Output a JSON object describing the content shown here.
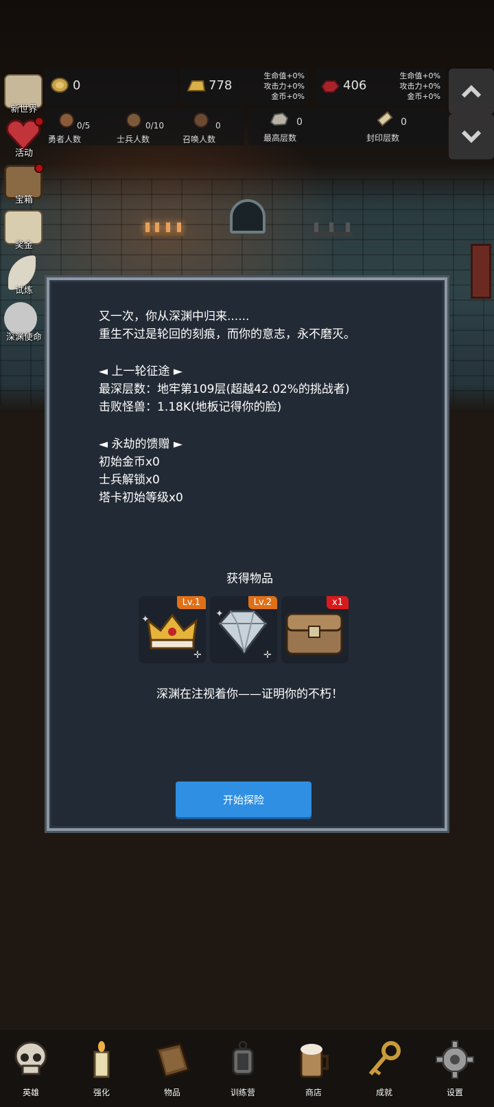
{
  "resources": {
    "gold": {
      "icon": "gold-coin-icon",
      "value": "0"
    },
    "gold_bar": {
      "icon": "gold-bar-icon",
      "value": "778",
      "bonus": [
        "生命值+0%",
        "攻击力+0%",
        "金币+0%"
      ]
    },
    "ruby": {
      "icon": "ruby-icon",
      "value": "406",
      "bonus": [
        "生命值+0%",
        "攻击力+0%",
        "金币+0%"
      ]
    }
  },
  "stats": [
    {
      "icon": "hero-head-icon",
      "value": "0/5",
      "label": "勇者人数"
    },
    {
      "icon": "soldier-head-icon",
      "value": "0/10",
      "label": "士兵人数"
    },
    {
      "icon": "summon-head-icon",
      "value": "0",
      "label": "召唤人数"
    },
    {
      "icon": "rock-icon",
      "value": "0",
      "label": "最高层数"
    },
    {
      "icon": "scroll-icon",
      "value": "0",
      "label": "封印层数"
    }
  ],
  "side_menu": [
    {
      "icon": "map-icon",
      "label": "新世界"
    },
    {
      "icon": "heart-icon",
      "label": "活动"
    },
    {
      "icon": "treasure-chest-icon",
      "label": "宝箱"
    },
    {
      "icon": "envelope-icon",
      "label": "奖金"
    },
    {
      "icon": "feather-icon",
      "label": "试炼"
    },
    {
      "icon": "orb-icon",
      "label": "深渊使命"
    }
  ],
  "modal": {
    "lines": [
      "又一次，你从深渊中归来......",
      "重生不过是轮回的刻痕，而你的意志，永不磨灭。",
      "◄ 上一轮征途 ►",
      "最深层数：地牢第109层(超越42.02%的挑战者)",
      "击败怪兽：1.18K(地板记得你的脸)",
      "◄ 永劫的馈赠 ►",
      "初始金币x0",
      "士兵解锁x0",
      "塔卡初始等级x0"
    ],
    "items_title": "获得物品",
    "items": [
      {
        "icon": "crown-icon",
        "badge": "Lv.1",
        "badge_color": "#e07018"
      },
      {
        "icon": "diamond-icon",
        "badge": "Lv.2",
        "badge_color": "#e07018"
      },
      {
        "icon": "treasure-chest-icon",
        "badge": "x1",
        "badge_color": "#d81a1a"
      }
    ],
    "footer": "深渊在注视着你——证明你的不朽！",
    "start_button": "开始探险"
  },
  "bottom_nav": [
    {
      "icon": "skull-icon",
      "label": "英雄"
    },
    {
      "icon": "candle-icon",
      "label": "强化"
    },
    {
      "icon": "book-icon",
      "label": "物品"
    },
    {
      "icon": "lantern-icon",
      "label": "训练营"
    },
    {
      "icon": "beer-mug-icon",
      "label": "商店"
    },
    {
      "icon": "key-icon",
      "label": "成就"
    },
    {
      "icon": "gear-icon",
      "label": "设置"
    }
  ],
  "colors": {
    "accent_button": "#2f8fe2",
    "badge_level": "#e07018",
    "badge_count": "#d81a1a",
    "modal_bg": "#222a35"
  }
}
